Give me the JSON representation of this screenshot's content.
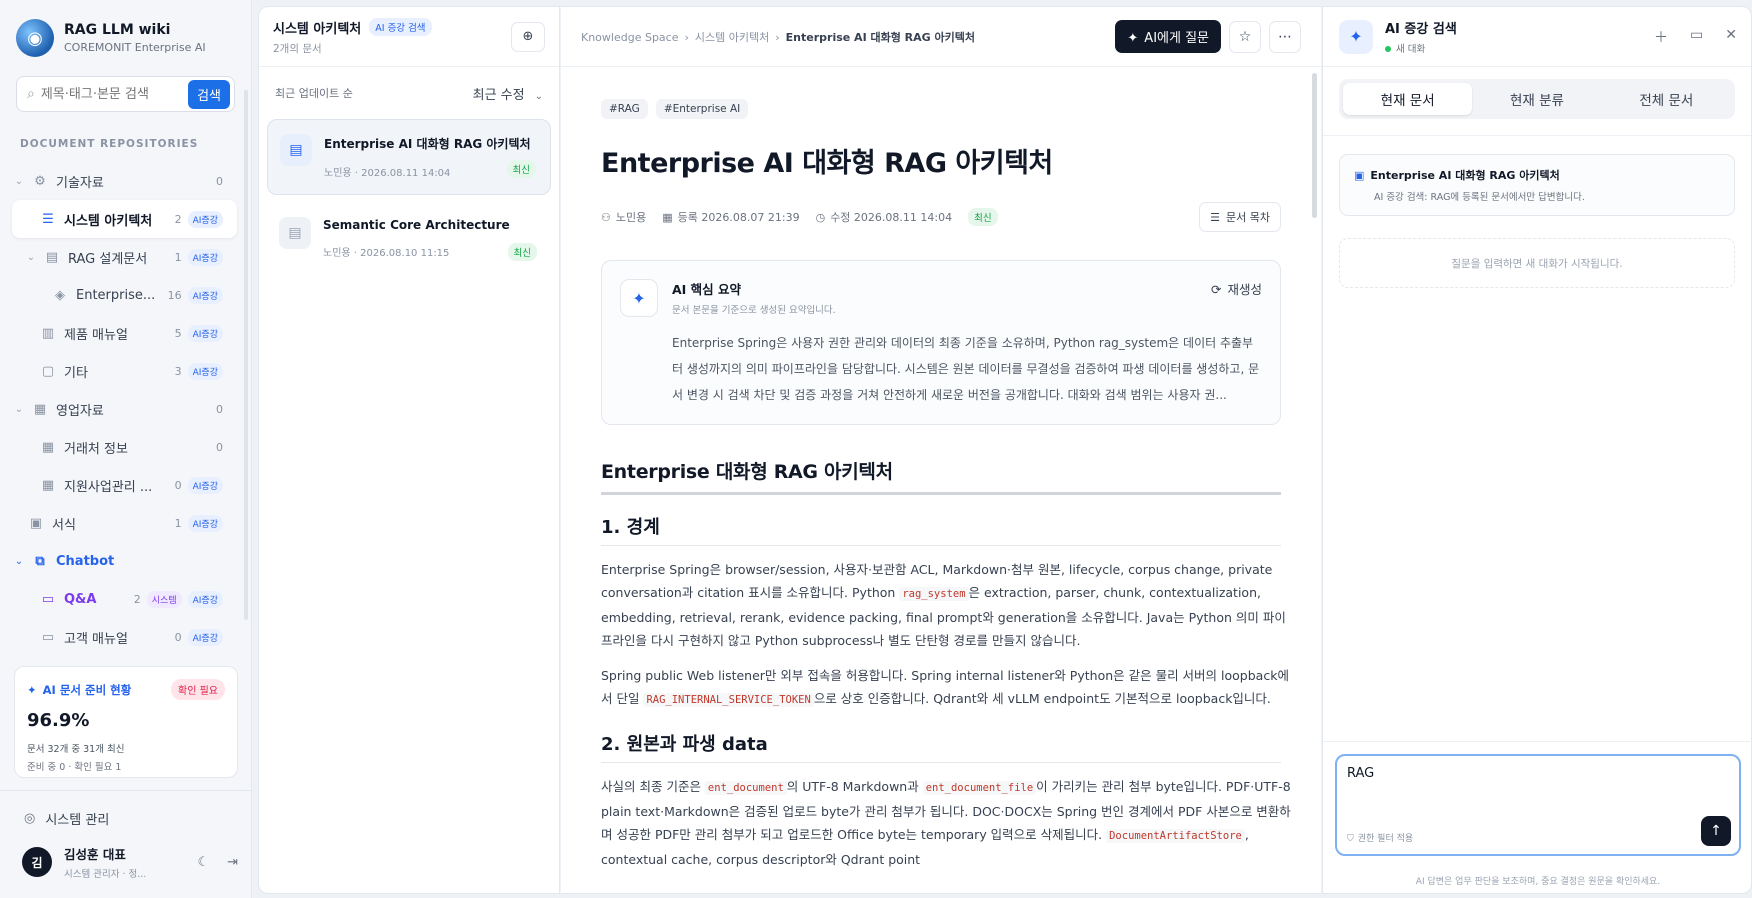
{
  "brand": {
    "name": "RAG LLM wiki",
    "subtitle": "COREMONIT Enterprise AI"
  },
  "sidebar": {
    "search_placeholder": "제목·태그·본문 검색",
    "search_button": "검색",
    "repo_heading": "DOCUMENT REPOSITORIES",
    "items": [
      {
        "label": "기술자료",
        "count": "0",
        "badge": ""
      },
      {
        "label": "시스템 아키텍처",
        "count": "2",
        "badge": "AI증강"
      },
      {
        "label": "RAG 설계문서",
        "count": "1",
        "badge": "AI증강"
      },
      {
        "label": "Enterprise...",
        "count": "16",
        "badge": "AI증강"
      },
      {
        "label": "제품 매뉴얼",
        "count": "5",
        "badge": "AI증강"
      },
      {
        "label": "기타",
        "count": "3",
        "badge": "AI증강"
      },
      {
        "label": "영업자료",
        "count": "0",
        "badge": ""
      },
      {
        "label": "거래처 정보",
        "count": "0",
        "badge": ""
      },
      {
        "label": "지원사업관리 ...",
        "count": "0",
        "badge": "AI증강"
      },
      {
        "label": "서식",
        "count": "1",
        "badge": "AI증강"
      },
      {
        "label": "Chatbot",
        "count": "",
        "badge": ""
      },
      {
        "label": "Q&A",
        "count": "2",
        "badge": "AI증강",
        "badge2": "시스템"
      },
      {
        "label": "고객 매뉴얼",
        "count": "0",
        "badge": "AI증강"
      }
    ],
    "ready": {
      "title": "AI 문서 준비 현황",
      "badge": "확인 필요",
      "percent": "96.9%",
      "line1": "문서 32개 중 31개 최신",
      "line2": "준비 중 0 · 확인 필요 1"
    },
    "system_admin": "시스템 관리",
    "user": {
      "initial": "김",
      "name": "김성훈 대표",
      "sub": "시스템 관리자 · 정..."
    }
  },
  "list_panel": {
    "title": "시스템 아키텍처",
    "badge": "AI 증강 검색",
    "count": "2개의 문서",
    "sort_label": "최근 업데이트 순",
    "sort_value": "최근 수정",
    "docs": [
      {
        "title": "Enterprise AI 대화형 RAG 아키텍처",
        "author": "노민용",
        "date": "2026.08.11 14:04",
        "badge": "최신"
      },
      {
        "title": "Semantic Core Architecture",
        "author": "노민용",
        "date": "2026.08.10 11:15",
        "badge": "최신"
      }
    ]
  },
  "main": {
    "breadcrumb": [
      "Knowledge Space",
      "시스템 아키텍처",
      "Enterprise AI 대화형 RAG 아키텍처"
    ],
    "ask_button": "AI에게 질문",
    "tags": [
      "#RAG",
      "#Enterprise AI"
    ],
    "title": "Enterprise AI 대화형 RAG 아키텍처",
    "author": "노민용",
    "registered": "등록 2026.08.07 21:39",
    "modified": "수정 2026.08.11 14:04",
    "status": "최신",
    "toc_button": "문서 목차",
    "summary": {
      "title": "AI 핵심 요약",
      "subtitle": "문서 본문을 기준으로 생성된 요약입니다.",
      "regen": "재생성",
      "text": "Enterprise Spring은 사용자 권한 관리와 데이터의 최종 기준을 소유하며, Python rag_system은 데이터 추출부터 생성까지의 의미 파이프라인을 담당합니다. 시스템은 원본 데이터를 무결성을 검증하여 파생 데이터를 생성하고, 문서 변경 시 검색 차단 및 검증 과정을 거쳐 안전하게 새로운 버전을 공개합니다. 대화와 검색 범위는 사용자 권..."
    },
    "section_title": "Enterprise 대화형 RAG 아키텍처",
    "sub1": "1. 경계",
    "p1": {
      "a": "Enterprise Spring은 browser/session, 사용자·보관함 ACL, Markdown·첨부 원본, lifecycle, corpus change, private conversation과 citation 표시를 소유합니다. Python ",
      "code": "rag_system",
      "b": "은 extraction, parser, chunk, contextualization, embedding, retrieval, rerank, evidence packing, final prompt와 generation을 소유합니다. Java는 Python 의미 파이프라인을 다시 구현하지 않고 Python subprocess나 별도 단탄형 경로를 만들지 않습니다."
    },
    "p2": {
      "a": "Spring public Web listener만 외부 접속을 허용합니다. Spring internal listener와 Python은 같은 물리 서버의 loopback에서 단일 ",
      "code": "RAG_INTERNAL_SERVICE_TOKEN",
      "b": "으로 상호 인증합니다. Qdrant와 세 vLLM endpoint도 기본적으로 loopback입니다."
    },
    "sub2": "2. 원본과 파생 data",
    "p3": {
      "a": "사실의 최종 기준은 ",
      "code1": "ent_document",
      "b": "의 UTF-8 Markdown과 ",
      "code2": "ent_document_file",
      "c": "이 가리키는 관리 첨부 byte입니다. PDF·UTF-8 plain text·Markdown은 검증된 업로드 byte가 관리 첨부가 됩니다. DOC·DOCX는 Spring 번인 경계에서 PDF 사본으로 변환하며 성공한 PDF만 관리 첨부가 되고 업로드한 Office byte는 temporary 입력으로 삭제됩니다. ",
      "code3": "DocumentArtifactStore",
      "d": ", contextual cache, corpus descriptor와 Qdrant point"
    }
  },
  "ai_panel": {
    "title": "AI 증강 검색",
    "status": "새 대화",
    "tabs": [
      "현재 문서",
      "현재 분류",
      "전체 문서"
    ],
    "context_title": "Enterprise AI 대화형 RAG 아키텍처",
    "context_sub": "AI 증강 검색: RAG에 등록된 문서에서만 답변합니다.",
    "empty_hint": "질문을 입력하면 새 대화가 시작됩니다.",
    "input_value": "RAG",
    "filter_label": "권한 필터 적용",
    "disclaimer": "AI 답변은 업무 판단을 보조하며, 중요 결정은 원문을 확인하세요."
  }
}
